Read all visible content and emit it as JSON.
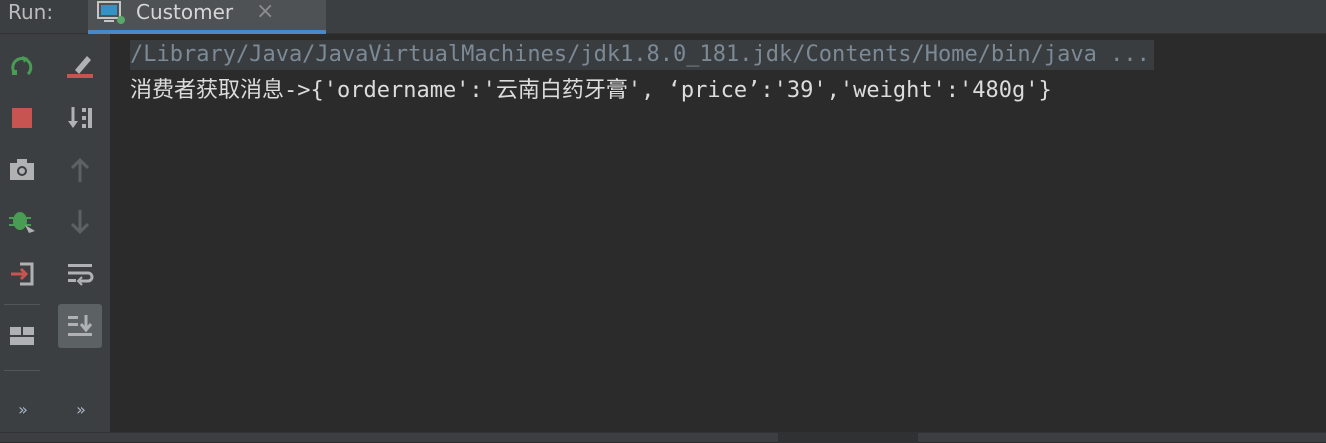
{
  "header": {
    "run_label": "Run:",
    "tab_title": "Customer",
    "tab_close": "×"
  },
  "toolbar_left": {
    "items": [
      {
        "name": "rerun-icon",
        "color": "#499c54"
      },
      {
        "name": "stop-icon",
        "color": "#c75450"
      },
      {
        "name": "camera-icon",
        "color": "#afb1b3"
      },
      {
        "name": "debug-icon",
        "color": "#499c54"
      },
      {
        "name": "exit-icon",
        "color": "#c75450"
      },
      {
        "name": "layout-icon",
        "color": "#afb1b3"
      }
    ],
    "more": "»"
  },
  "toolbar_right": {
    "items": [
      {
        "name": "clear-all-icon",
        "color": "#c75450"
      },
      {
        "name": "sort-icon",
        "color": "#afb1b3"
      },
      {
        "name": "up-arrow-icon",
        "color": "#5e6163"
      },
      {
        "name": "down-arrow-icon",
        "color": "#5e6163"
      },
      {
        "name": "soft-wrap-icon",
        "color": "#afb1b3"
      },
      {
        "name": "scroll-to-end-icon",
        "color": "#afb1b3"
      }
    ],
    "more": "»"
  },
  "console": {
    "command_line": "/Library/Java/JavaVirtualMachines/jdk1.8.0_181.jdk/Contents/Home/bin/java ...",
    "output_line": "消费者获取消息->{'ordername':'云南白药牙膏', ‘price’:'39','weight':'480g'}"
  }
}
